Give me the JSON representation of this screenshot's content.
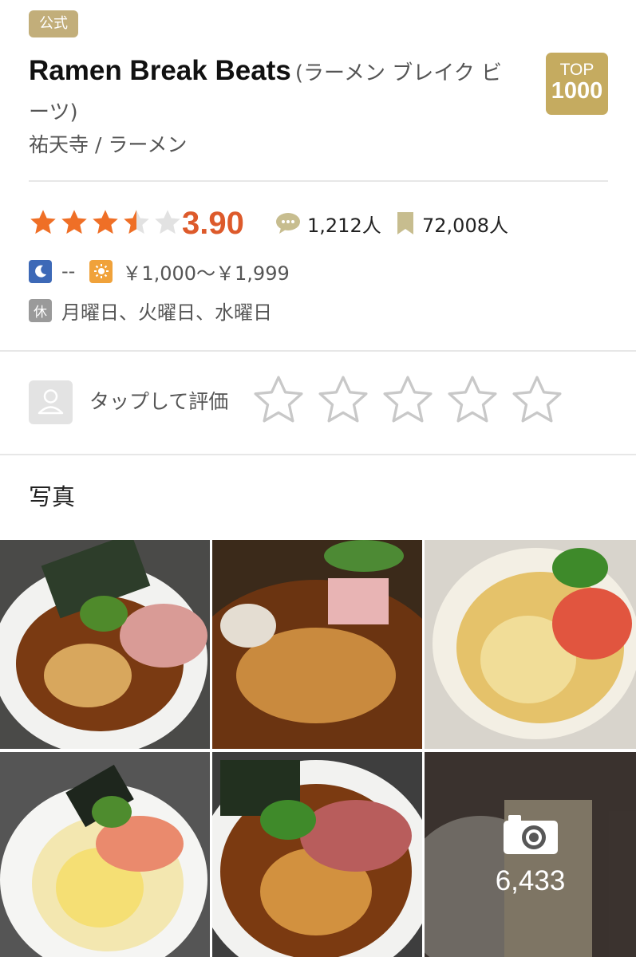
{
  "header": {
    "official_badge": "公式",
    "name": "Ramen Break Beats",
    "name_kana": "(ラーメン ブレイク ビーツ)",
    "award_line1": "TOP",
    "award_line2": "1000",
    "area_genre": "祐天寺 / ラーメン"
  },
  "rating": {
    "stars": 3.5,
    "score": "3.90",
    "reviews": "1,212人",
    "bookmarks": "72,008人"
  },
  "budget": {
    "dinner": "--",
    "lunch": "￥1,000～￥1,999"
  },
  "holiday": {
    "icon_label": "休",
    "days": "月曜日、火曜日、水曜日"
  },
  "user_rating": {
    "prompt": "タップして評価"
  },
  "photos": {
    "section_title": "写真",
    "count": "6,433"
  },
  "colors": {
    "accent": "#dd5a2b",
    "star": "#ef6f26",
    "gold": "#c5ab60",
    "official": "#c2ae7a"
  }
}
